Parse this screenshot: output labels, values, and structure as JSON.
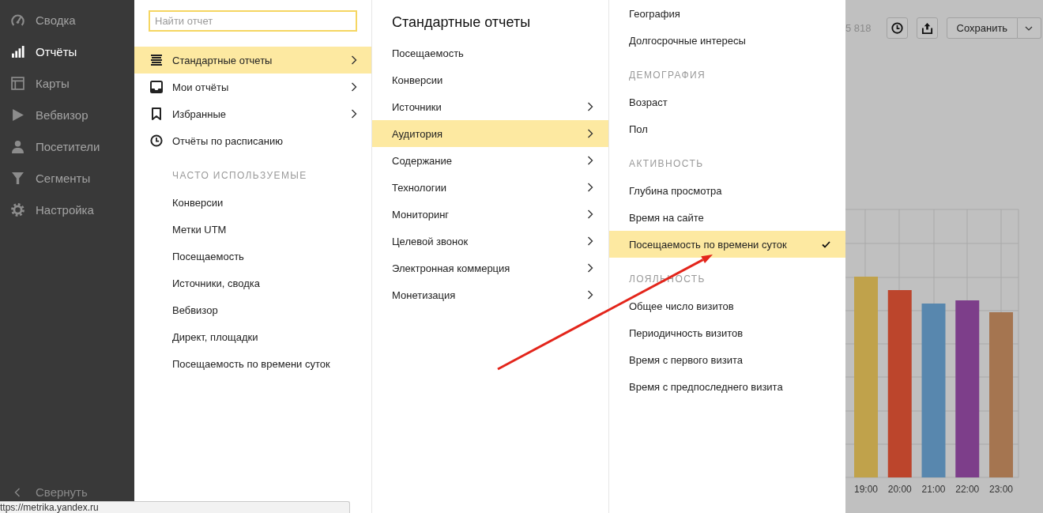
{
  "sidebar": {
    "items": [
      {
        "label": "Сводка",
        "selected": false
      },
      {
        "label": "Отчёты",
        "selected": true
      },
      {
        "label": "Карты",
        "selected": false
      },
      {
        "label": "Вебвизор",
        "selected": false
      },
      {
        "label": "Посетители",
        "selected": false
      },
      {
        "label": "Сегменты",
        "selected": false
      },
      {
        "label": "Настройка",
        "selected": false
      }
    ],
    "collapse": "Свернуть"
  },
  "reports_menu": {
    "search": {
      "placeholder": "Найти отчет"
    },
    "items": [
      {
        "label": "Стандартные отчеты",
        "submenu": true,
        "selected": true
      },
      {
        "label": "Мои отчёты",
        "submenu": true,
        "selected": false
      },
      {
        "label": "Избранные",
        "submenu": true,
        "selected": false
      },
      {
        "label": "Отчёты по расписанию",
        "submenu": false,
        "selected": false
      }
    ],
    "frequent": {
      "heading": "ЧАСТО ИСПОЛЬЗУЕМЫЕ",
      "items": [
        {
          "label": "Конверсии",
          "selected": false
        },
        {
          "label": "Метки UTM",
          "selected": false
        },
        {
          "label": "Посещаемость",
          "selected": false
        },
        {
          "label": "Источники, сводка",
          "selected": false
        },
        {
          "label": "Вебвизор",
          "selected": false
        },
        {
          "label": "Директ, площадки",
          "selected": false
        },
        {
          "label": "Посещаемость по времени суток",
          "selected": false
        }
      ]
    }
  },
  "standard_reports": {
    "title": "Стандартные отчеты",
    "items": [
      {
        "label": "Посещаемость",
        "submenu": false,
        "selected": false
      },
      {
        "label": "Конверсии",
        "submenu": false,
        "selected": false
      },
      {
        "label": "Источники",
        "submenu": true,
        "selected": false
      },
      {
        "label": "Аудитория",
        "submenu": true,
        "selected": true
      },
      {
        "label": "Содержание",
        "submenu": true,
        "selected": false
      },
      {
        "label": "Технологии",
        "submenu": true,
        "selected": false
      },
      {
        "label": "Мониторинг",
        "submenu": true,
        "selected": false
      },
      {
        "label": "Целевой звонок",
        "submenu": true,
        "selected": false
      },
      {
        "label": "Электронная коммерция",
        "submenu": true,
        "selected": false
      },
      {
        "label": "Монетизация",
        "submenu": true,
        "selected": false
      }
    ]
  },
  "audience": {
    "entries": [
      {
        "kind": "item",
        "label": "География",
        "selected": false
      },
      {
        "kind": "item",
        "label": "Долгосрочные интересы",
        "selected": false
      },
      {
        "kind": "heading",
        "label": "ДЕМОГРАФИЯ"
      },
      {
        "kind": "item",
        "label": "Возраст",
        "selected": false
      },
      {
        "kind": "item",
        "label": "Пол",
        "selected": false
      },
      {
        "kind": "heading",
        "label": "АКТИВНОСТЬ"
      },
      {
        "kind": "item",
        "label": "Глубина просмотра",
        "selected": false
      },
      {
        "kind": "item",
        "label": "Время на сайте",
        "selected": false
      },
      {
        "kind": "item",
        "label": "Посещаемость по времени суток",
        "selected": true
      },
      {
        "kind": "heading",
        "label": "ЛОЯЛЬНОСТЬ"
      },
      {
        "kind": "item",
        "label": "Общее число визитов",
        "selected": false
      },
      {
        "kind": "item",
        "label": "Периодичность визитов",
        "selected": false
      },
      {
        "kind": "item",
        "label": "Время с первого визита",
        "selected": false
      },
      {
        "kind": "item",
        "label": "Время с предпоследнего визита",
        "selected": false
      }
    ]
  },
  "toolbar": {
    "counter": "5 818",
    "save": "Сохранить"
  },
  "chart": {
    "bars": [
      {
        "label": "19:00",
        "color": "#c0a24b"
      },
      {
        "label": "20:00",
        "color": "#bc452c"
      },
      {
        "label": "21:00",
        "color": "#5887ae"
      },
      {
        "label": "22:00",
        "color": "#7d3e8a"
      },
      {
        "label": "23:00",
        "color": "#a57550"
      }
    ]
  },
  "status_bar": {
    "url": "ttps://metrika.yandex.ru"
  }
}
